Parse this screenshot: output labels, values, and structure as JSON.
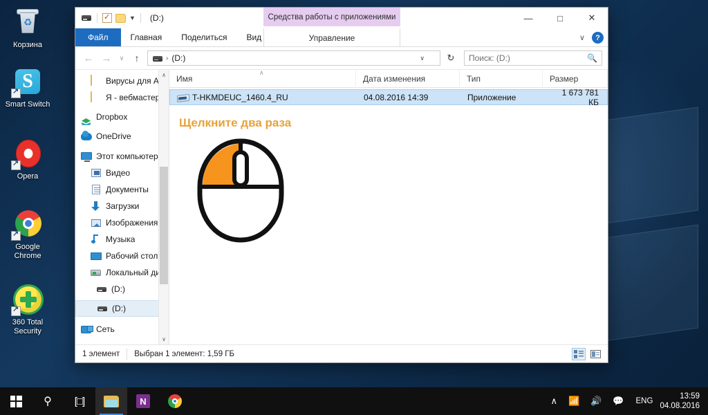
{
  "desktop": {
    "icons": [
      {
        "label": "Корзина",
        "icon": "recycle-bin-icon"
      },
      {
        "label": "Smart Switch",
        "icon": "smart-switch-icon"
      },
      {
        "label": "Opera",
        "icon": "opera-icon"
      },
      {
        "label": "Google\nChrome",
        "icon": "chrome-icon"
      },
      {
        "label": "360 Total\nSecurity",
        "icon": "360-total-security-icon"
      }
    ]
  },
  "explorer": {
    "quick_access": {
      "drive_icon": "drive-icon",
      "properties_icon": "properties-checkbox-icon",
      "new_folder_icon": "new-folder-icon",
      "customize_caret": "▼",
      "location_label": "(D:)"
    },
    "contextual_tab_header": "Средства работы с приложениями",
    "window_controls": {
      "minimize": "—",
      "maximize": "□",
      "close": "✕",
      "collapse_ribbon": "∨",
      "help": "?"
    },
    "tabs": [
      {
        "label": "Файл",
        "selected": true
      },
      {
        "label": "Главная",
        "selected": false
      },
      {
        "label": "Поделиться",
        "selected": false
      },
      {
        "label": "Вид",
        "selected": false
      }
    ],
    "contextual_tab": "Управление",
    "address": {
      "back": "←",
      "forward": "→",
      "history_caret": "∨",
      "up": "↑",
      "path_label": "(D:)",
      "path_separator": "›",
      "dropdown_caret": "∨",
      "refresh": "↻"
    },
    "search": {
      "placeholder": "Поиск: (D:)",
      "icon": "search-icon"
    },
    "sidebar": {
      "items": [
        {
          "label": "Вирусы для Анд",
          "icon": "folder-icon",
          "indent": 1,
          "selected": false
        },
        {
          "label": "Я - вебмастер",
          "icon": "folder-icon",
          "indent": 1,
          "selected": false
        },
        {
          "label": "Dropbox",
          "icon": "dropbox-icon",
          "indent": 0,
          "selected": false
        },
        {
          "label": "OneDrive",
          "icon": "onedrive-icon",
          "indent": 0,
          "selected": false
        },
        {
          "label": "Этот компьютер",
          "icon": "this-pc-icon",
          "indent": 0,
          "selected": false
        },
        {
          "label": "Видео",
          "icon": "video-icon",
          "indent": 1,
          "selected": false
        },
        {
          "label": "Документы",
          "icon": "documents-icon",
          "indent": 1,
          "selected": false
        },
        {
          "label": "Загрузки",
          "icon": "downloads-icon",
          "indent": 1,
          "selected": false
        },
        {
          "label": "Изображения",
          "icon": "pictures-icon",
          "indent": 1,
          "selected": false
        },
        {
          "label": "Музыка",
          "icon": "music-icon",
          "indent": 1,
          "selected": false
        },
        {
          "label": "Рабочий стол",
          "icon": "desktop-icon",
          "indent": 1,
          "selected": false
        },
        {
          "label": "Локальный дис",
          "icon": "local-disk-icon",
          "indent": 1,
          "selected": false
        },
        {
          "label": "(D:)",
          "icon": "drive-icon",
          "indent": 1,
          "selected": false
        },
        {
          "label": "(D:)",
          "icon": "drive-icon",
          "indent": 1,
          "selected": true
        },
        {
          "label": "Сеть",
          "icon": "network-icon",
          "indent": 0,
          "selected": false
        }
      ],
      "scroll_up": "∧",
      "scroll_down": "∨"
    },
    "columns": [
      {
        "label": "Имя"
      },
      {
        "label": "Дата изменения"
      },
      {
        "label": "Тип"
      },
      {
        "label": "Размер"
      }
    ],
    "sort_indicator": "∧",
    "rows": [
      {
        "name": "T-HKMDEUC_1460.4_RU",
        "date": "04.08.2016 14:39",
        "type": "Приложение",
        "size": "1 673 781 КБ",
        "icon": "application-exe-icon",
        "selected": true
      }
    ],
    "annotation": {
      "text": "Щелкните два раза",
      "color": "#e8a13a",
      "illustration": "mouse-double-click-diagram",
      "highlight_color": "#f7941e"
    },
    "status": {
      "item_count": "1 элемент",
      "selection": "Выбран 1 элемент: 1,59 ГБ",
      "view_details_icon": "details-view-icon",
      "view_large_icon": "large-icons-view-icon"
    }
  },
  "taskbar": {
    "start": "start-button",
    "search": "search-icon",
    "task_view": "task-view-icon",
    "apps": [
      {
        "name": "file-explorer",
        "active": true
      },
      {
        "name": "onenote",
        "label": "N",
        "active": false
      },
      {
        "name": "google-chrome",
        "active": false
      }
    ],
    "tray": {
      "show_hidden": "∧",
      "network": "network-icon",
      "volume": "volume-icon",
      "action_center": "action-center-icon",
      "language": "ENG"
    },
    "clock": {
      "time": "13:59",
      "date": "04.08.2016"
    }
  }
}
